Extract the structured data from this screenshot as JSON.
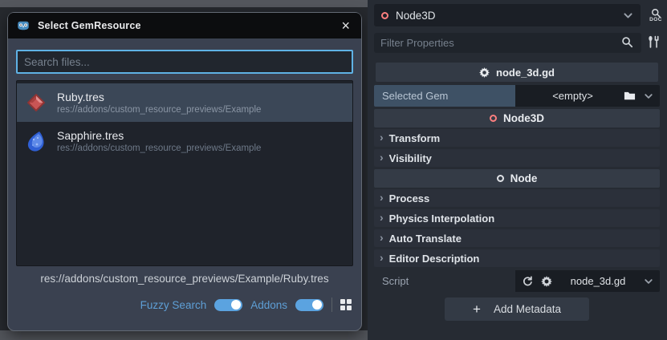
{
  "dialog": {
    "title": "Select GemResource",
    "search_placeholder": "Search files...",
    "files": [
      {
        "name": "Ruby.tres",
        "path": "res://addons/custom_resource_previews/Example",
        "selected": true,
        "gem_color": "red"
      },
      {
        "name": "Sapphire.tres",
        "path": "res://addons/custom_resource_previews/Example",
        "selected": false,
        "gem_color": "blue"
      }
    ],
    "selected_file_path": "res://addons/custom_resource_previews/Example/Ruby.tres",
    "fuzzy_search_label": "Fuzzy Search",
    "fuzzy_search_on": true,
    "addons_label": "Addons",
    "addons_on": true
  },
  "inspector": {
    "node_type": "Node3D",
    "doc_label": "DOC",
    "filter_placeholder": "Filter Properties",
    "script_header": "node_3d.gd",
    "selected_gem": {
      "label": "Selected Gem",
      "value": "<empty>"
    },
    "category_node3d": "Node3D",
    "category_node": "Node",
    "groups": [
      {
        "label": "Transform"
      },
      {
        "label": "Visibility"
      },
      {
        "label": "Process"
      },
      {
        "label": "Physics Interpolation"
      },
      {
        "label": "Auto Translate"
      },
      {
        "label": "Editor Description"
      }
    ],
    "script_row": {
      "label": "Script",
      "value": "node_3d.gd"
    },
    "add_metadata_label": "Add Metadata"
  },
  "icons": {
    "close": "×",
    "plus": "+",
    "group_arrow": "›"
  },
  "colors": {
    "accent_blue": "#5fb2e5",
    "toggle_blue": "#5ba3e0",
    "node3d_red": "#fc7f7f",
    "godot_blue": "#478cbf",
    "panel_bg": "#262b33",
    "dialog_bg": "#3a4150"
  }
}
